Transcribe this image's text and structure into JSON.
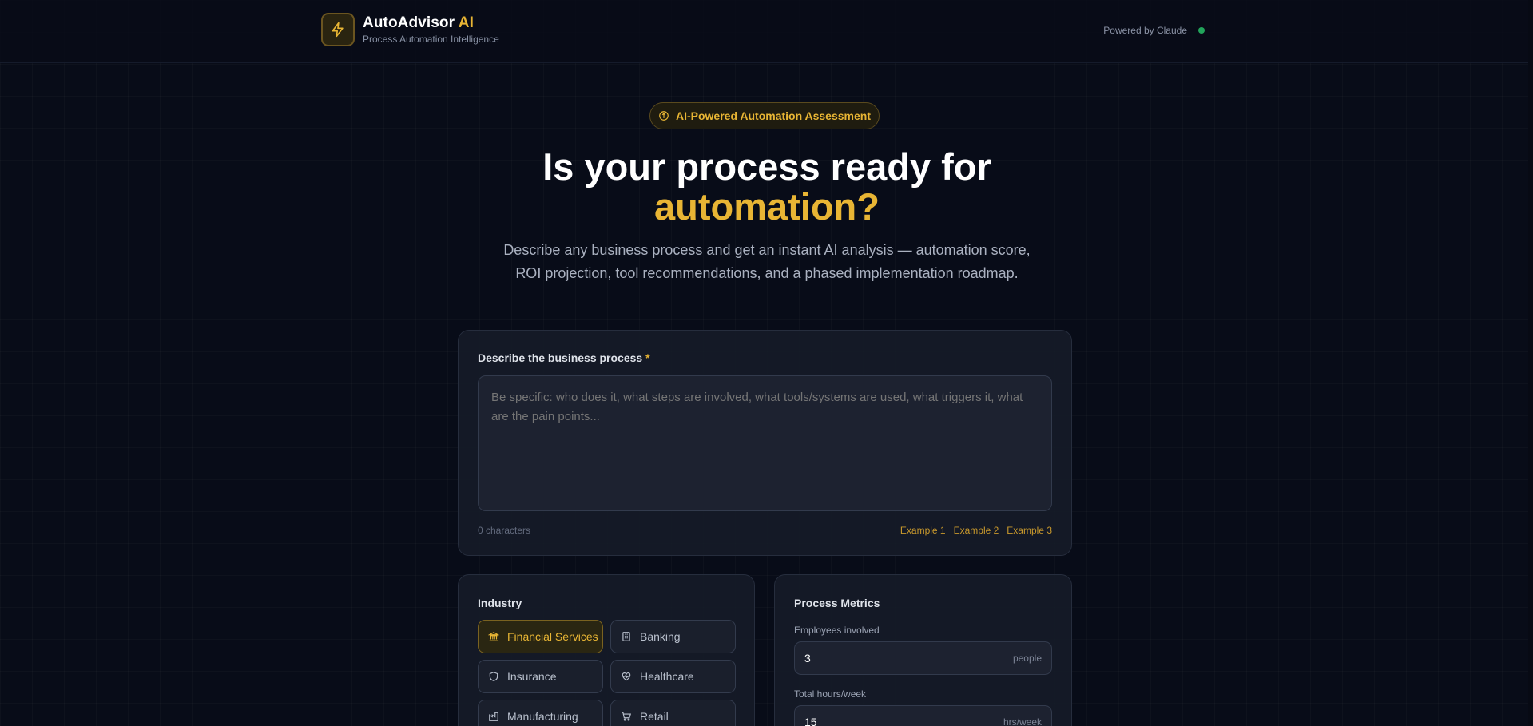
{
  "header": {
    "brand_name": "AutoAdvisor",
    "brand_suffix": "AI",
    "tagline": "Process Automation Intelligence",
    "powered_by": "Powered by Claude",
    "status_color": "#22a55b"
  },
  "hero": {
    "badge": "AI-Powered Automation Assessment",
    "title_line1": "Is your process ready for",
    "title_line2": "automation?",
    "subtitle_line1": "Describe any business process and get an instant AI analysis — automation score,",
    "subtitle_line2": "ROI projection, tool recommendations, and a phased implementation roadmap."
  },
  "process_form": {
    "label": "Describe the business process",
    "required_mark": "*",
    "placeholder": "Be specific: who does it, what steps are involved, what tools/systems are used, what triggers it, what are the pain points...",
    "value": "",
    "char_count": "0 characters",
    "examples": [
      "Example 1",
      "Example 2",
      "Example 3"
    ]
  },
  "industry": {
    "label": "Industry",
    "selected": "Financial Services",
    "options": [
      {
        "label": "Financial Services",
        "icon": "bank-icon"
      },
      {
        "label": "Banking",
        "icon": "building-icon"
      },
      {
        "label": "Insurance",
        "icon": "shield-icon"
      },
      {
        "label": "Healthcare",
        "icon": "heart-pulse-icon"
      },
      {
        "label": "Manufacturing",
        "icon": "factory-icon"
      },
      {
        "label": "Retail",
        "icon": "cart-icon"
      }
    ]
  },
  "metrics": {
    "label": "Process Metrics",
    "employees": {
      "label": "Employees involved",
      "value": "3",
      "unit": "people"
    },
    "hours": {
      "label": "Total hours/week",
      "value": "15",
      "unit": "hrs/week"
    }
  },
  "colors": {
    "accent": "#e8b534",
    "background": "#080c18",
    "card": "#161b28"
  }
}
